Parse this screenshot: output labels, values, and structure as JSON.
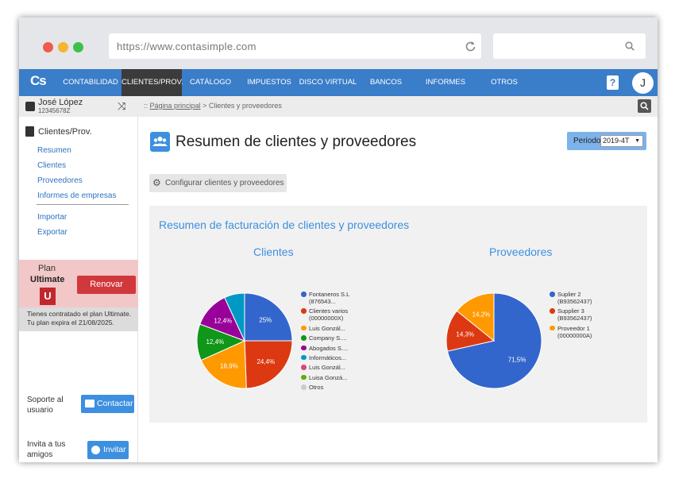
{
  "browser": {
    "url": "https://www.contasimple.com"
  },
  "nav": {
    "logo": "Cs",
    "items": [
      {
        "label": "CONTABILIDAD"
      },
      {
        "label": "CLIENTES/PROV."
      },
      {
        "label": "CATÁLOGO"
      },
      {
        "label": "IMPUESTOS"
      },
      {
        "label": "DISCO VIRTUAL"
      },
      {
        "label": "BANCOS"
      },
      {
        "label": "INFORMES"
      },
      {
        "label": "OTROS"
      }
    ],
    "help": "?",
    "avatar": "J"
  },
  "user": {
    "name": "José López",
    "id": "12345678Z"
  },
  "breadcrumb": {
    "prefix": "::",
    "home": "Página principal",
    "current": "> Clientes y proveedores"
  },
  "sidebar": {
    "section_title": "Clientes/Prov.",
    "links": [
      {
        "label": "Resumen"
      },
      {
        "label": "Clientes"
      },
      {
        "label": "Proveedores"
      },
      {
        "label": "Informes de empresas"
      },
      {
        "label": "Importar"
      },
      {
        "label": "Exportar"
      }
    ],
    "plan": {
      "label": "Plan",
      "name": "Ultimate",
      "badge": "U",
      "renew": "Renovar",
      "info_line1": "Tienes contratado el plan Ultimate.",
      "info_line2": "Tu plan expira el 21/08/2025."
    },
    "support": {
      "label_line1": "Soporte al",
      "label_line2": "usuario",
      "button": "Contactar"
    },
    "invite": {
      "label_line1": "Invita a tus",
      "label_line2": "amigos",
      "button": "Invitar"
    }
  },
  "main": {
    "title": "Resumen de clientes y proveedores",
    "period_label": "Periodo",
    "period_value": "2019-4T",
    "period_arrow": "▼",
    "config_button": "Configurar clientes y proveedores",
    "panel_title": "Resumen de facturación de clientes y proveedores"
  },
  "colors": {
    "accent": "#3d8fe0",
    "nav": "#3a7dc9",
    "renew": "#d1383c"
  },
  "chart_data": [
    {
      "type": "pie",
      "title": "Clientes",
      "series": [
        {
          "name": "Fontaneros S.L (876543...",
          "value": 25,
          "label": "25%",
          "color": "#3366cc"
        },
        {
          "name": "Clientes varios (00000000X)",
          "value": 24.4,
          "label": "24,4%",
          "color": "#dc3912"
        },
        {
          "name": "Luis Gonzál...",
          "value": 18.9,
          "label": "18,9%",
          "color": "#ff9900"
        },
        {
          "name": "Company S....",
          "value": 12.4,
          "label": "12,4%",
          "color": "#109618"
        },
        {
          "name": "Abogados S....",
          "value": 12.4,
          "label": "12,4%",
          "color": "#990099"
        },
        {
          "name": "Informáticos...",
          "value": 6.9,
          "label": "",
          "color": "#0099c6"
        },
        {
          "name": "Luis Gonzál...",
          "value": 0,
          "label": "",
          "color": "#dd4477"
        },
        {
          "name": "Luisa Gonzá...",
          "value": 0,
          "label": "",
          "color": "#66aa00"
        },
        {
          "name": "Otros",
          "value": 0,
          "label": "",
          "color": "#cccccc"
        }
      ]
    },
    {
      "type": "pie",
      "title": "Proveedores",
      "series": [
        {
          "name": "Suplier 2 (B93562437)",
          "value": 71.5,
          "label": "71,5%",
          "color": "#3366cc"
        },
        {
          "name": "Supplier 3 (B93562437)",
          "value": 14.3,
          "label": "14,3%",
          "color": "#dc3912"
        },
        {
          "name": "Proveedor 1 (00000000A)",
          "value": 14.2,
          "label": "14,2%",
          "color": "#ff9900"
        }
      ]
    }
  ]
}
